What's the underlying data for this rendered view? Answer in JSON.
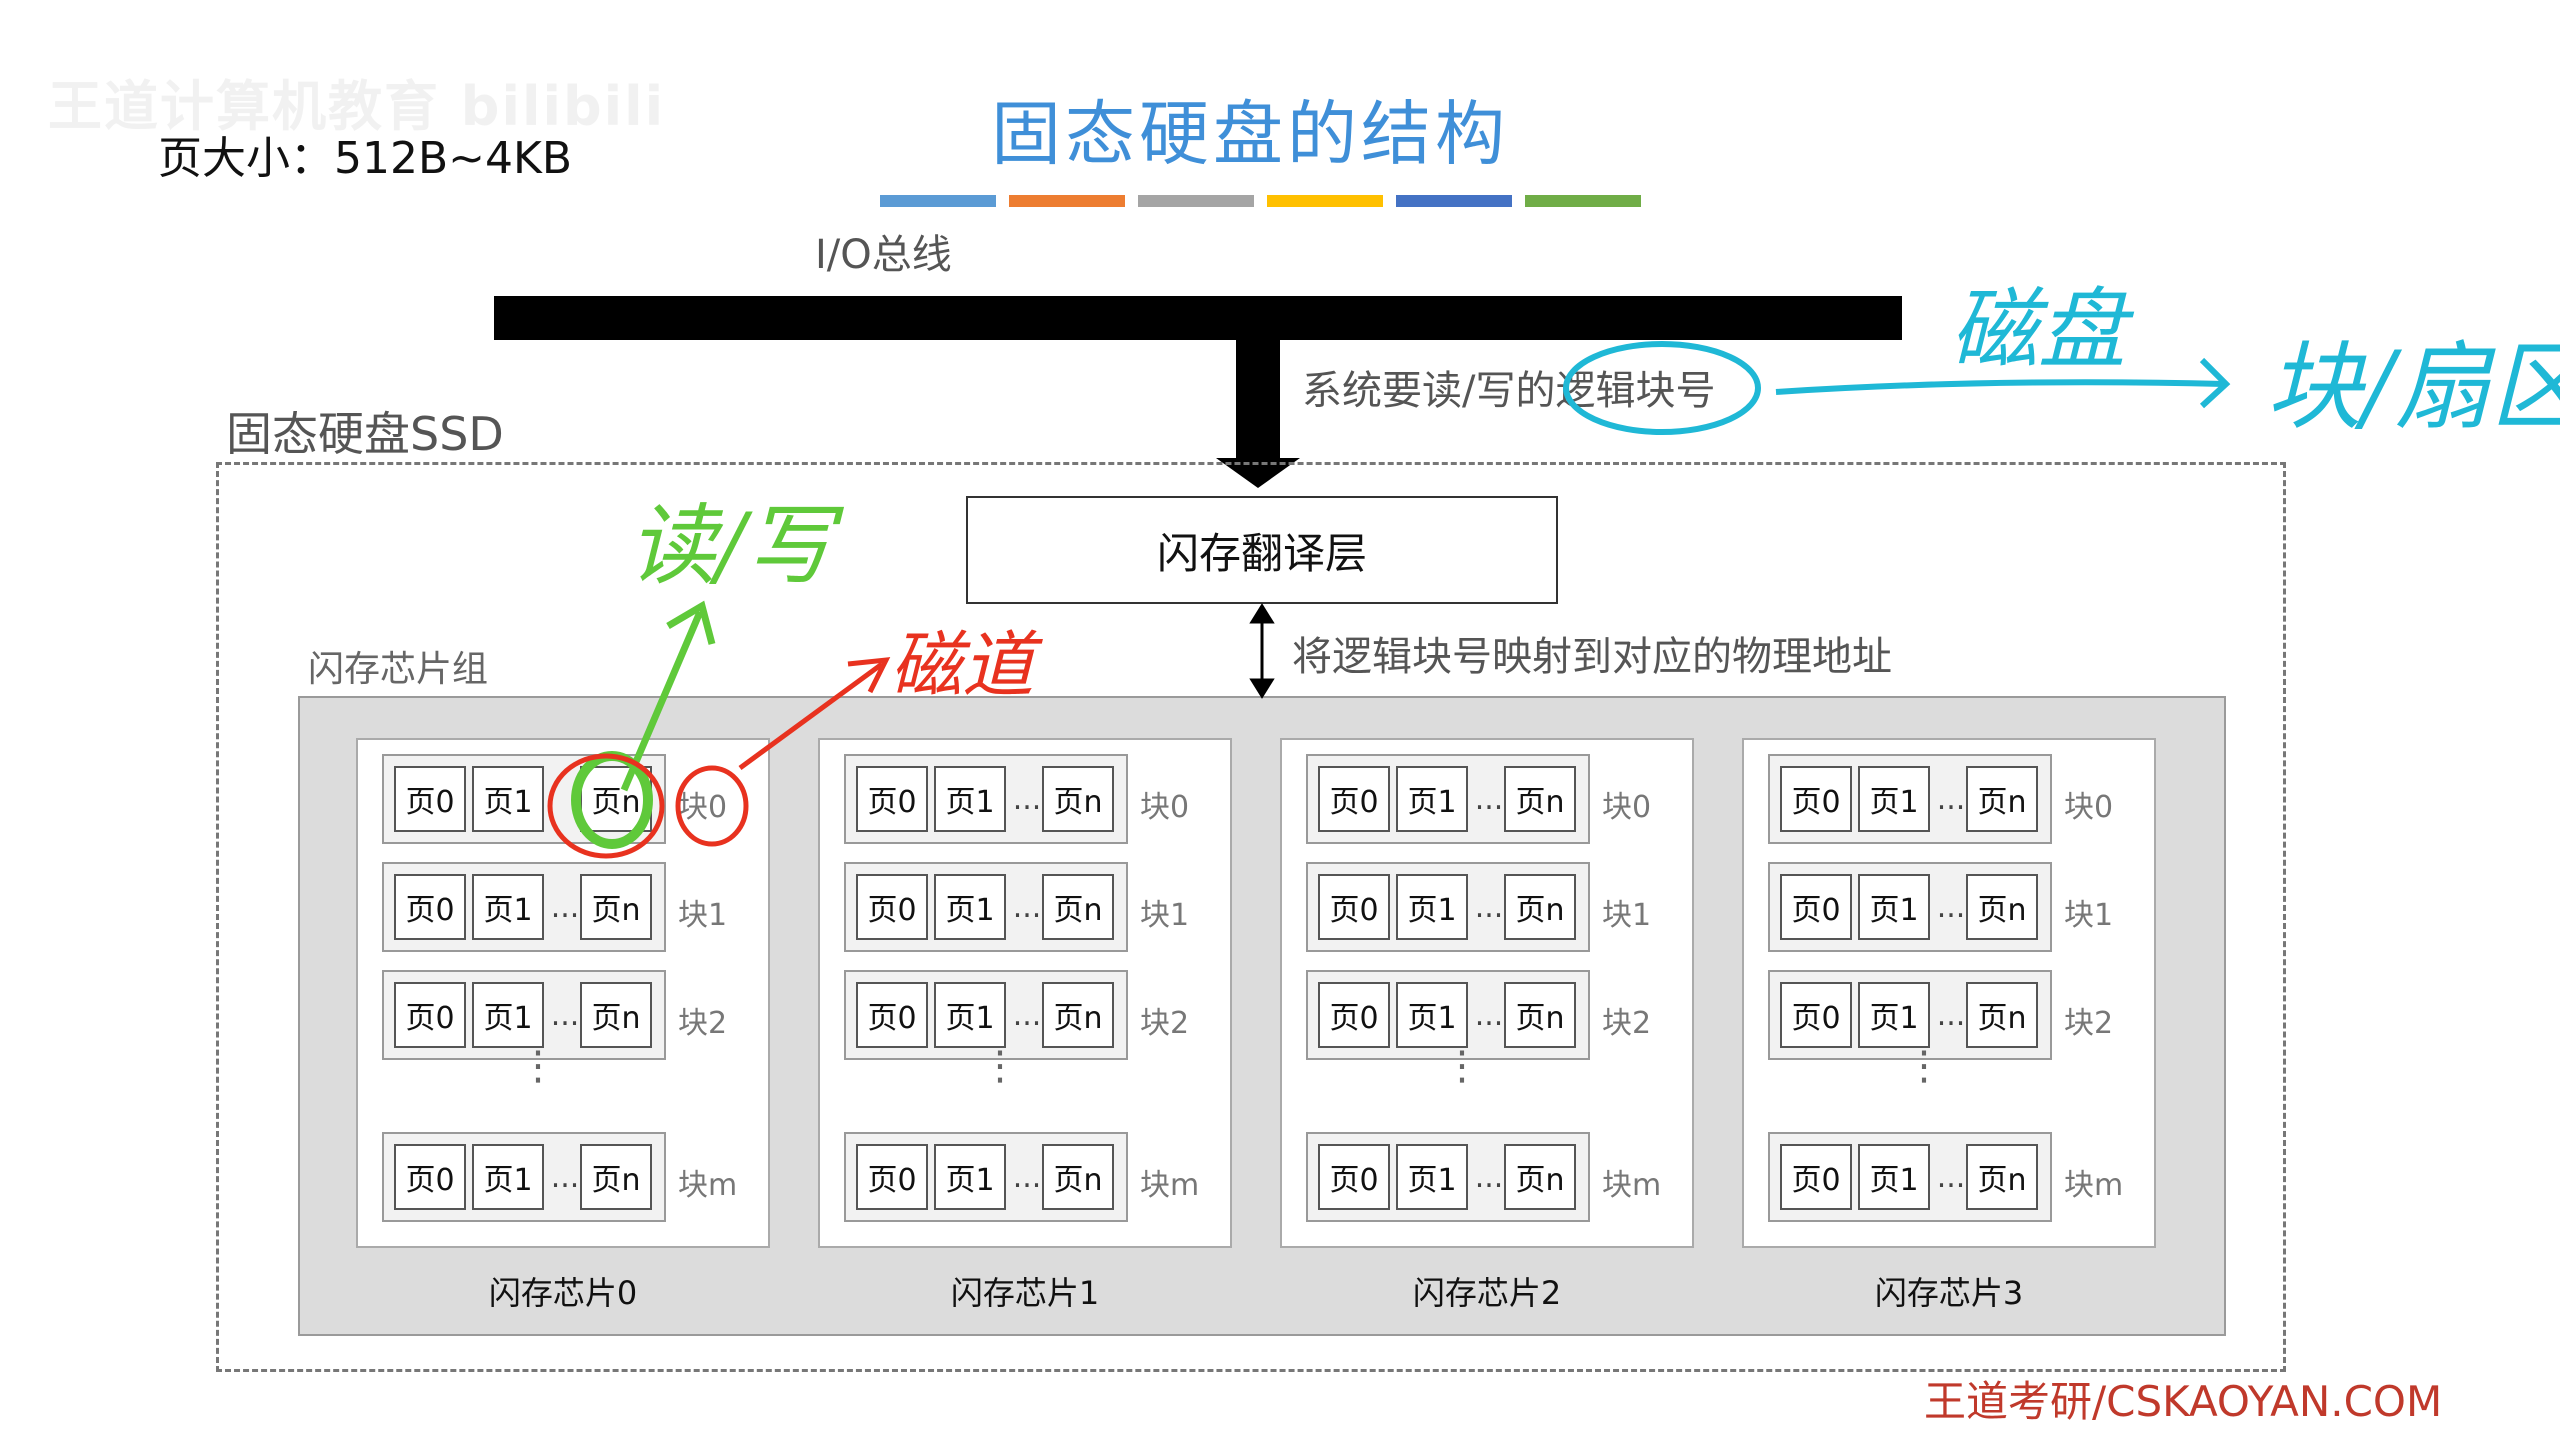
{
  "watermark": "王道计算机教育 bilibili",
  "page_size_note": "页大小：512B~4KB",
  "title": "固态硬盘的结构",
  "accent_colors": [
    "#5b9bd5",
    "#ed7d31",
    "#a5a5a5",
    "#ffc000",
    "#4472c4",
    "#70ad47"
  ],
  "io_bus_label": "I/O总线",
  "read_write_logical": "系统要读/写的逻辑块号",
  "ssd_label": "固态硬盘SSD",
  "ftl_label": "闪存翻译层",
  "mapping_note": "将逻辑块号映射到对应的物理地址",
  "chip_group_label": "闪存芯片组",
  "chips": [
    {
      "label": "闪存芯片0",
      "blocks": [
        "块0",
        "块1",
        "块2",
        "块m"
      ]
    },
    {
      "label": "闪存芯片1",
      "blocks": [
        "块0",
        "块1",
        "块2",
        "块m"
      ]
    },
    {
      "label": "闪存芯片2",
      "blocks": [
        "块0",
        "块1",
        "块2",
        "块m"
      ]
    },
    {
      "label": "闪存芯片3",
      "blocks": [
        "块0",
        "块1",
        "块2",
        "块m"
      ]
    }
  ],
  "page_labels": {
    "p0": "页0",
    "p1": "页1",
    "pn": "页n",
    "ellipsis": "...",
    "vellipsis": "⋮"
  },
  "handwriting": {
    "disk": "磁盘",
    "block_sector": "块/扇区",
    "read_write": "读/写",
    "track": "磁道"
  },
  "footer": "王道考研/CSKAOYAN.COM"
}
